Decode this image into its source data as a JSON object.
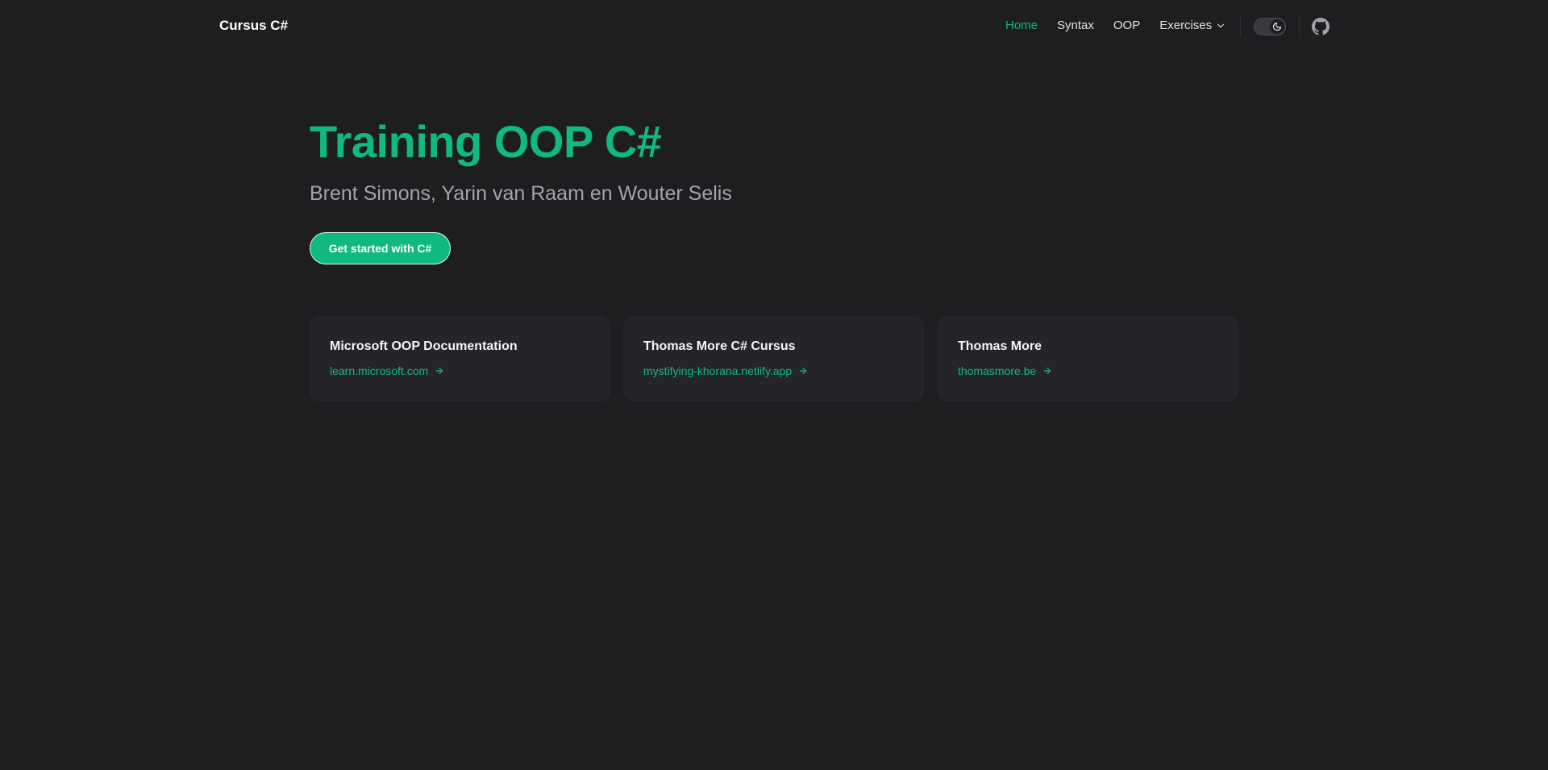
{
  "nav": {
    "brand": "Cursus C#",
    "links": [
      {
        "label": "Home",
        "active": true
      },
      {
        "label": "Syntax",
        "active": false
      },
      {
        "label": "OOP",
        "active": false
      },
      {
        "label": "Exercises",
        "active": false,
        "dropdown": true
      }
    ],
    "theme_toggle_icon": "moon-icon",
    "github_icon": "github-icon"
  },
  "hero": {
    "title": "Training OOP C#",
    "subtitle": "Brent Simons, Yarin van Raam en Wouter Selis",
    "cta_label": "Get started with C#"
  },
  "cards": [
    {
      "title": "Microsoft OOP Documentation",
      "link": "learn.microsoft.com"
    },
    {
      "title": "Thomas More C# Cursus",
      "link": "mystifying-khorana.netlify.app"
    },
    {
      "title": "Thomas More",
      "link": "thomasmore.be"
    }
  ],
  "colors": {
    "background": "#1e1e20",
    "accent": "#10b981",
    "card_background": "#252529",
    "subtitle": "#a3a3a8"
  }
}
